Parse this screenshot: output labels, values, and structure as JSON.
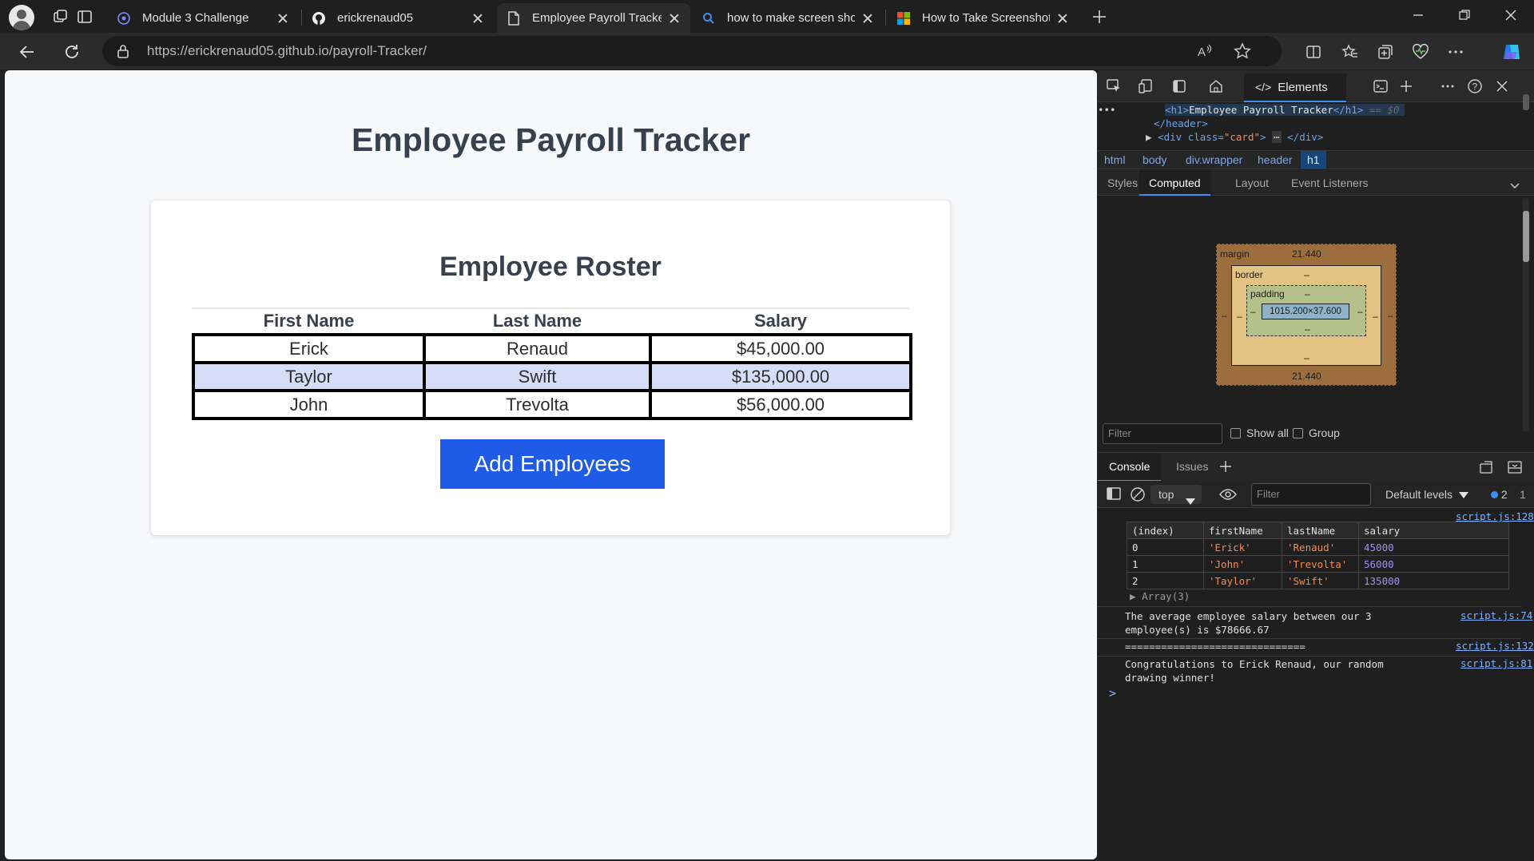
{
  "browser": {
    "tabs": [
      {
        "title": "Module 3 Challenge",
        "icon": "module-icon"
      },
      {
        "title": "erickrenaud05",
        "icon": "github-icon"
      },
      {
        "title": "Employee Payroll Tracker",
        "icon": "page-icon",
        "active": true
      },
      {
        "title": "how to make screen shot on win",
        "icon": "search-icon"
      },
      {
        "title": "How to Take Screenshots on Win",
        "icon": "microsoft-icon"
      }
    ],
    "url": "https://erickrenaud05.github.io/payroll-Tracker/"
  },
  "page": {
    "title": "Employee Payroll Tracker",
    "card_title": "Employee Roster",
    "columns": [
      "First Name",
      "Last Name",
      "Salary"
    ],
    "rows": [
      [
        "Erick",
        "Renaud",
        "$45,000.00"
      ],
      [
        "Taylor",
        "Swift",
        "$135,000.00"
      ],
      [
        "John",
        "Trevolta",
        "$56,000.00"
      ]
    ],
    "add_button": "Add Employees"
  },
  "devtools": {
    "elements_tab": "Elements",
    "dom": {
      "line1_open": "<h1>",
      "line1_text": "Employee Payroll Tracker",
      "line1_close": "</h1>",
      "line1_marker": "== $0",
      "line2": "</header>",
      "line3_tag": "<div class=",
      "line3_attr": "\"card\"",
      "line3_close": "</div>"
    },
    "breadcrumbs": [
      "html",
      "body",
      "div.wrapper",
      "header",
      "h1"
    ],
    "subtabs": [
      "Styles",
      "Computed",
      "Layout",
      "Event Listeners"
    ],
    "box_model": {
      "margin_label": "margin",
      "margin_top": "21.440",
      "margin_bottom": "21.440",
      "border_label": "border",
      "padding_label": "padding",
      "dash": "–",
      "content": "1015.200×37.600"
    },
    "computed_filter_placeholder": "Filter",
    "show_all": "Show all",
    "group": "Group",
    "drawer_tabs": [
      "Console",
      "Issues"
    ],
    "console_context": "top",
    "console_filter_placeholder": "Filter",
    "default_levels": "Default levels",
    "issue_count": "2",
    "issue_count_2": "1",
    "console": {
      "src1": "script.js:128",
      "table_headers": [
        "(index)",
        "firstName",
        "lastName",
        "salary"
      ],
      "table_rows": [
        [
          "0",
          "'Erick'",
          "'Renaud'",
          "45000"
        ],
        [
          "1",
          "'John'",
          "'Trevolta'",
          "56000"
        ],
        [
          "2",
          "'Taylor'",
          "'Swift'",
          "135000"
        ]
      ],
      "array_label": "Array(3)",
      "avg_msg": "The average employee salary between our 3 employee(s) is $78666.67",
      "src2": "script.js:74",
      "separator": "==============================",
      "src3": "script.js:132",
      "winner_msg": "Congratulations to Erick Renaud, our random drawing winner!",
      "src4": "script.js:81",
      "prompt": ">"
    }
  }
}
